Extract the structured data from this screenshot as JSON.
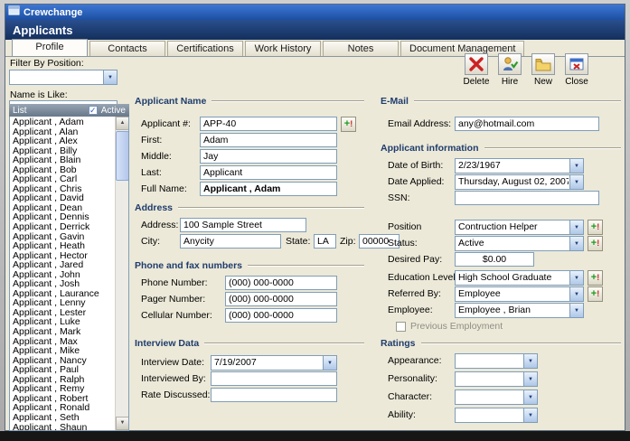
{
  "window": {
    "title": "Crewchange",
    "header": "Applicants"
  },
  "colors": {
    "header_bg": "#132f5c",
    "titlebar_blue": "#1c4fa2",
    "window_bg": "#ece9d8",
    "input_border": "#7f9db9",
    "add_button_green": "#1f9b1f"
  },
  "tabs": {
    "items": [
      {
        "label": "Profile",
        "active": true
      },
      {
        "label": "Contacts",
        "active": false
      },
      {
        "label": "Certifications",
        "active": false
      },
      {
        "label": "Work History",
        "active": false
      },
      {
        "label": "Notes",
        "active": false
      },
      {
        "label": "Document Management",
        "active": false
      }
    ]
  },
  "toolbar": {
    "buttons": [
      {
        "label": "Delete",
        "icon": "delete-icon"
      },
      {
        "label": "Hire",
        "icon": "hire-icon"
      },
      {
        "label": "New",
        "icon": "new-icon"
      },
      {
        "label": "Close",
        "icon": "close-icon"
      }
    ]
  },
  "sidebar": {
    "filter_label": "Filter By Position:",
    "filter_value": "",
    "name_label": "Name is Like:",
    "name_value": "*",
    "list_title": "List",
    "active_label": "Active",
    "active_checked": true,
    "applicants": [
      "Applicant , Adam",
      "Applicant , Alan",
      "Applicant , Alex",
      "Applicant , Billy",
      "Applicant , Blain",
      "Applicant , Bob",
      "Applicant , Carl",
      "Applicant , Chris",
      "Applicant , David",
      "Applicant , Dean",
      "Applicant , Dennis",
      "Applicant , Derrick",
      "Applicant , Gavin",
      "Applicant , Heath",
      "Applicant , Hector",
      "Applicant , Jared",
      "Applicant , John",
      "Applicant , Josh",
      "Applicant , Laurance",
      "Applicant , Lenny",
      "Applicant , Lester",
      "Applicant , Luke",
      "Applicant , Mark",
      "Applicant , Max",
      "Applicant , Mike",
      "Applicant , Nancy",
      "Applicant , Paul",
      "Applicant , Ralph",
      "Applicant , Remy",
      "Applicant , Robert",
      "Applicant , Ronald",
      "Applicant , Seth",
      "Applicant , Shaun"
    ]
  },
  "profile": {
    "applicant_name": {
      "title": "Applicant Name",
      "no_label": "Applicant #:",
      "no": "APP-40",
      "first_label": "First:",
      "first": "Adam",
      "middle_label": "Middle:",
      "middle": "Jay",
      "last_label": "Last:",
      "last": "Applicant",
      "full_label": "Full Name:",
      "full": "Applicant , Adam"
    },
    "address": {
      "title": "Address",
      "address_label": "Address:",
      "address": "100 Sample Street",
      "city_label": "City:",
      "city": "Anycity",
      "state_label": "State:",
      "state": "LA",
      "zip_label": "Zip:",
      "zip": "00000"
    },
    "phones": {
      "title": "Phone and fax numbers",
      "phone_label": "Phone Number:",
      "phone": "(000) 000-0000",
      "pager_label": "Pager Number:",
      "pager": "(000) 000-0000",
      "cellular_label": "Cellular Number:",
      "cellular": "(000) 000-0000"
    },
    "interview": {
      "title": "Interview Data",
      "date_label": "Interview Date:",
      "date": "7/19/2007",
      "by_label": "Interviewed By:",
      "by": "",
      "rate_label": "Rate Discussed:",
      "rate": ""
    },
    "email": {
      "title": "E-Mail",
      "label": "Email Address:",
      "value": "any@hotmail.com"
    },
    "info": {
      "title": "Applicant information",
      "dob_label": "Date of Birth:",
      "dob": "2/23/1967",
      "applied_label": "Date Applied:",
      "applied": "Thursday, August 02, 2007",
      "ssn_label": "SSN:",
      "ssn": "",
      "position_label": "Position",
      "position": "Contruction Helper",
      "status_label": "Status:",
      "status": "Active",
      "pay_label": "Desired Pay:",
      "pay": "$0.00",
      "education_label": "Education Level:",
      "education": "High School Graduate",
      "referred_label": "Referred By:",
      "referred": "Employee",
      "employee_label": "Employee:",
      "employee": "Employee , Brian",
      "prev_label": "Previous Employment",
      "prev_checked": false
    },
    "ratings": {
      "title": "Ratings",
      "appearance_label": "Appearance:",
      "appearance": "",
      "personality_label": "Personality:",
      "personality": "",
      "character_label": "Character:",
      "character": "",
      "ability_label": "Ability:",
      "ability": ""
    }
  }
}
